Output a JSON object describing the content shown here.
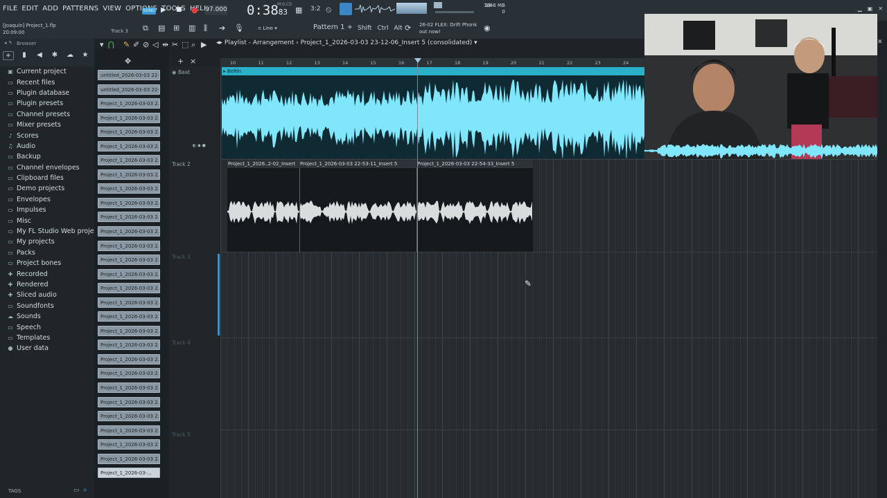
{
  "menu": [
    "FILE",
    "EDIT",
    "ADD",
    "PATTERNS",
    "VIEW",
    "OPTIONS",
    "TOOLS",
    "HELP"
  ],
  "toolbar": {
    "song_label": "SONG",
    "tempo": "97.000",
    "time": "0:38",
    "time_ms": "83",
    "time_unit": "M:S:CS",
    "mem_top": "18",
    "mem_mb": "1046 MB",
    "mem_bottom": "0"
  },
  "project": {
    "user": "[Joaquin]",
    "filename": "Project_1.flp",
    "time": "20:09:00",
    "hint_track": "Track 3"
  },
  "row2": {
    "line_mode": "Line",
    "pattern": "Pattern 1",
    "keys": [
      "Shift",
      "Ctrl",
      "Alt"
    ],
    "news_date": "26-02",
    "news_line1": "FLEX: Drift Phonk",
    "news_line2": "out now!"
  },
  "browser": {
    "title": "Browser",
    "items": [
      {
        "label": "Current project",
        "icon": "project-icon"
      },
      {
        "label": "Recent files",
        "icon": "folder-icon"
      },
      {
        "label": "Plugin database",
        "icon": "folder-icon"
      },
      {
        "label": "Plugin presets",
        "icon": "folder-icon"
      },
      {
        "label": "Channel presets",
        "icon": "folder-icon"
      },
      {
        "label": "Mixer presets",
        "icon": "folder-icon"
      },
      {
        "label": "Scores",
        "icon": "score-icon"
      },
      {
        "label": "Audio",
        "icon": "audio-icon"
      },
      {
        "label": "Backup",
        "icon": "folder-icon"
      },
      {
        "label": "Channel envelopes",
        "icon": "folder-icon"
      },
      {
        "label": "Clipboard files",
        "icon": "folder-icon"
      },
      {
        "label": "Demo projects",
        "icon": "folder-icon"
      },
      {
        "label": "Envelopes",
        "icon": "folder-icon"
      },
      {
        "label": "Impulses",
        "icon": "folder-icon"
      },
      {
        "label": "Misc",
        "icon": "folder-icon"
      },
      {
        "label": "My FL Studio Web projects",
        "icon": "folder-icon"
      },
      {
        "label": "My projects",
        "icon": "folder-icon"
      },
      {
        "label": "Packs",
        "icon": "folder-icon"
      },
      {
        "label": "Project bones",
        "icon": "folder-icon"
      },
      {
        "label": "Recorded",
        "icon": "plus-icon"
      },
      {
        "label": "Rendered",
        "icon": "plus-icon"
      },
      {
        "label": "Sliced audio",
        "icon": "plus-icon"
      },
      {
        "label": "Soundfonts",
        "icon": "folder-icon"
      },
      {
        "label": "Sounds",
        "icon": "cloud-icon"
      },
      {
        "label": "Speech",
        "icon": "folder-icon"
      },
      {
        "label": "Templates",
        "icon": "folder-icon"
      },
      {
        "label": "User data",
        "icon": "user-icon"
      }
    ],
    "tags_label": "TAGS"
  },
  "clips": [
    "untitled_2026-03-03 22-...",
    "untitled_2026-03-03 22-...",
    "Project_1_2026-03-03 2...",
    "Project_1_2026-03-03 2...",
    "Project_1_2026-03-03 2...",
    "Project_1_2026-03-03 2...",
    "Project_1_2026-03-03 2...",
    "Project_1_2026-03-03 2...",
    "Project_1_2026-03-03 2...",
    "Project_1_2026-03-03 2...",
    "Project_1_2026-03-03 2...",
    "Project_1_2026-03-03 2...",
    "Project_1_2026-03-03 2...",
    "Project_1_2026-03-03 2...",
    "Project_1_2026-03-03 2...",
    "Project_1_2026-03-03 2...",
    "Project_1_2026-03-03 2...",
    "Project_1_2026-03-03 2...",
    "Project_1_2026-03-03 2...",
    "Project_1_2026-03-03 2...",
    "Project_1_2026-03-03 2...",
    "Project_1_2026-03-03 2...",
    "Project_1_2026-03-03 2...",
    "Project_1_2026-03-03 2...",
    "Project_1_2026-03-03 2...",
    "Project_1_2026-03-03 2...",
    "Project_1_2026-03-03 2...",
    "Project_1_2026-03-03 2...",
    "Project_1_2026-03-..."
  ],
  "playlist": {
    "title": "Playlist - Arrangement",
    "clip_path": "Project_1_2026-03-03 23-12-06_Insert 5 (consolidated)",
    "ruler": [
      "10",
      "11",
      "12",
      "13",
      "14",
      "15",
      "16",
      "17",
      "18",
      "19",
      "20",
      "21",
      "22",
      "23",
      "24"
    ],
    "tracks": [
      "Beat",
      "Track 2",
      "Track 3",
      "Track 4",
      "Track 5"
    ],
    "beat_clip": "Beltin",
    "vocal_clips": [
      "Project_1_2026..2-02_Insert",
      "Project_1_2026-03-03 22-53-11_Insert 5",
      "Project_1_2026-03-03 22-54-33_Insert 5"
    ],
    "colors": {
      "beat_clip": "#2ab0c9",
      "beat_wave": "#7fe6fb",
      "vocal_wave": "#d9dcdd"
    }
  }
}
